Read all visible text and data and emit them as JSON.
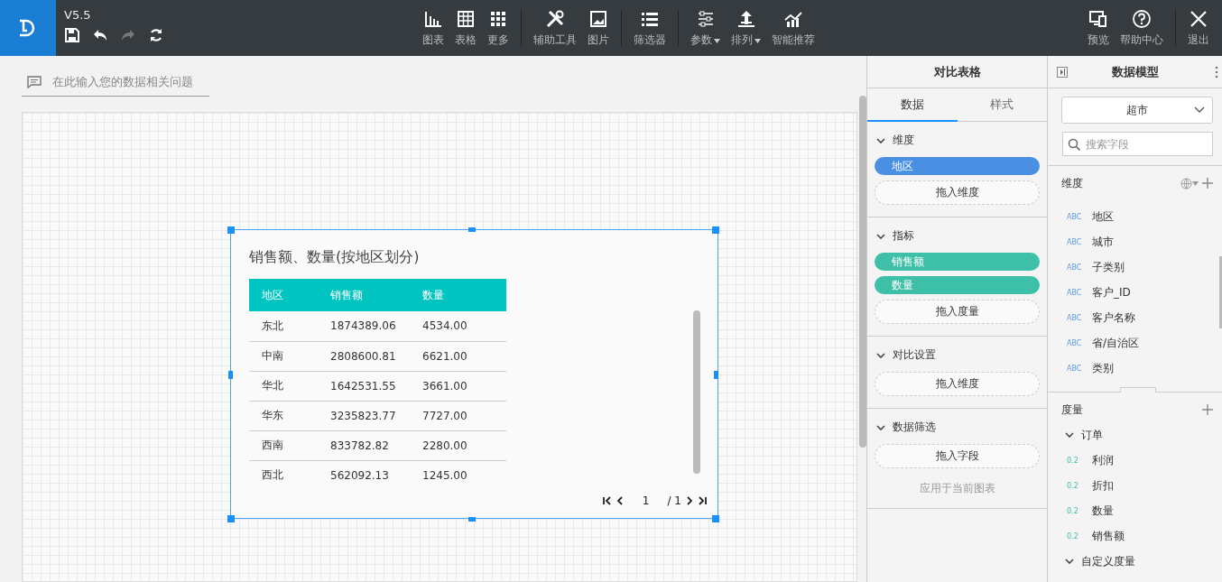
{
  "toolbar": {
    "version": "V5.5",
    "quick_actions": [
      {
        "kind": "save",
        "disabled": false
      },
      {
        "kind": "undo",
        "disabled": false
      },
      {
        "kind": "redo",
        "disabled": true
      },
      {
        "kind": "refresh",
        "disabled": false
      }
    ],
    "groups": [
      [
        {
          "kind": "chart",
          "label": "图表",
          "dropdown": false
        },
        {
          "kind": "table",
          "label": "表格",
          "dropdown": false
        },
        {
          "kind": "grid",
          "label": "更多",
          "dropdown": false
        }
      ],
      [
        {
          "kind": "tools",
          "label": "辅助工具",
          "dropdown": false
        },
        {
          "kind": "image",
          "label": "图片",
          "dropdown": false
        }
      ],
      [
        {
          "kind": "list",
          "label": "筛选器",
          "dropdown": false
        }
      ],
      [
        {
          "kind": "sliders",
          "label": "参数",
          "dropdown": true
        },
        {
          "kind": "upload",
          "label": "排列",
          "dropdown": true
        },
        {
          "kind": "trend",
          "label": "智能推荐",
          "dropdown": false
        }
      ]
    ],
    "right_actions": [
      [
        {
          "kind": "preview",
          "label": "预览"
        },
        {
          "kind": "help",
          "label": "帮助中心"
        }
      ],
      [
        {
          "kind": "close",
          "label": "退出"
        }
      ]
    ]
  },
  "question_bar": {
    "placeholder": "在此输入您的数据相关问题"
  },
  "widget": {
    "title": "销售额、数量(按地区划分)",
    "columns": [
      "地区",
      "销售额",
      "数量"
    ],
    "rows": [
      [
        "东北",
        "1874389.06",
        "4534.00"
      ],
      [
        "中南",
        "2808600.81",
        "6621.00"
      ],
      [
        "华北",
        "1642531.55",
        "3661.00"
      ],
      [
        "华东",
        "3235823.77",
        "7727.00"
      ],
      [
        "西南",
        "833782.82",
        "2280.00"
      ],
      [
        "西北",
        "562092.13",
        "1245.00"
      ]
    ],
    "pagination": {
      "page": "1",
      "total": "/ 1"
    }
  },
  "config_panel": {
    "title": "对比表格",
    "tabs": [
      {
        "label": "数据",
        "selected": true
      },
      {
        "label": "样式",
        "selected": false
      }
    ],
    "sections": [
      {
        "title": "维度",
        "expanded": true,
        "pills": [
          {
            "label": "地区",
            "color": "#4a90e2"
          }
        ],
        "drop_zone": "拖入维度"
      },
      {
        "title": "指标",
        "expanded": true,
        "pills": [
          {
            "label": "销售额",
            "color": "#3dbfa8"
          },
          {
            "label": "数量",
            "color": "#3dbfa8"
          }
        ],
        "drop_zone": "拖入度量"
      },
      {
        "title": "对比设置",
        "expanded": true,
        "drop_zone": "拖入维度"
      },
      {
        "title": "数据筛选",
        "expanded": true,
        "drop_zone": "拖入字段",
        "note": "应用于当前图表"
      }
    ]
  },
  "model_panel": {
    "title": "数据模型",
    "dataset": "超市",
    "search": {
      "placeholder": "搜索字段"
    },
    "dimensions": {
      "title": "维度",
      "fields": [
        {
          "kind": "dimension",
          "type": "ABC",
          "name": "地区"
        },
        {
          "kind": "dimension",
          "type": "ABC",
          "name": "城市"
        },
        {
          "kind": "dimension",
          "type": "ABC",
          "name": "子类别"
        },
        {
          "kind": "dimension",
          "type": "ABC",
          "name": "客户_ID"
        },
        {
          "kind": "dimension",
          "type": "ABC",
          "name": "客户名称"
        },
        {
          "kind": "dimension",
          "type": "ABC",
          "name": "省/自治区"
        },
        {
          "kind": "dimension",
          "type": "ABC",
          "name": "类别"
        }
      ]
    },
    "measures": {
      "title": "度量",
      "groups": [
        {
          "name": "订单",
          "expanded": true,
          "fields": [
            {
              "kind": "measure",
              "type": "0.2",
              "name": "利润"
            },
            {
              "kind": "measure",
              "type": "0.2",
              "name": "折扣"
            },
            {
              "kind": "measure",
              "type": "0.2",
              "name": "数量"
            },
            {
              "kind": "measure",
              "type": "0.2",
              "name": "销售额"
            }
          ]
        },
        {
          "name": "自定义度量",
          "expanded": true
        }
      ]
    }
  }
}
